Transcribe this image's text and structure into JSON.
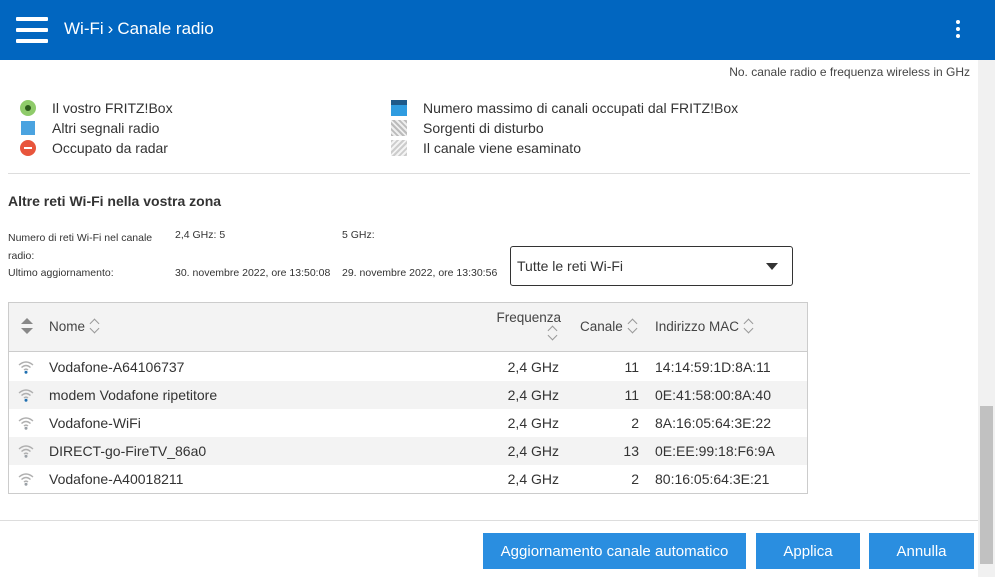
{
  "header": {
    "breadcrumb_parent": "Wi-Fi",
    "breadcrumb_separator": ">",
    "breadcrumb_current": "Canale radio"
  },
  "chart_note": "No. canale radio e frequenza wireless in GHz",
  "legend": [
    {
      "icon": "fritzbox-dot-icon",
      "label": "Il vostro FRITZ!Box"
    },
    {
      "icon": "other-signal-square-icon",
      "label": "Altri segnali radio"
    },
    {
      "icon": "radar-icon",
      "label": "Occupato da radar"
    },
    {
      "icon": "max-channels-icon",
      "label": "Numero massimo di canali occupati dal FRITZ!Box"
    },
    {
      "icon": "interference-icon",
      "label": "Sorgenti di disturbo"
    },
    {
      "icon": "scanning-icon",
      "label": "Il canale viene esaminato"
    }
  ],
  "section": {
    "title": "Altre reti Wi-Fi nella vostra zona",
    "count_label": "Numero di reti Wi-Fi nel canale radio:",
    "count_24": "2,4 GHz: 5",
    "count_5": "5 GHz:",
    "updated_label": "Ultimo aggiornamento:",
    "updated_24": "30. novembre 2022, ore 13:50:08",
    "updated_5": "29. novembre 2022, ore 13:30:56"
  },
  "filter": {
    "selected": "Tutte le reti Wi-Fi"
  },
  "table": {
    "headers": {
      "name": "Nome",
      "freq": "Frequenza",
      "channel": "Canale",
      "mac": "Indirizzo MAC"
    },
    "rows": [
      {
        "name": "Vodafone-A64106737",
        "freq": "2,4 GHz",
        "channel": "11",
        "mac": "14:14:59:1D:8A:11",
        "signal": 4
      },
      {
        "name": "modem Vodafone ripetitore",
        "freq": "2,4 GHz",
        "channel": "11",
        "mac": "0E:41:58:00:8A:40",
        "signal": 4
      },
      {
        "name": "Vodafone-WiFi",
        "freq": "2,4 GHz",
        "channel": "2",
        "mac": "8A:16:05:64:3E:22",
        "signal": 3
      },
      {
        "name": "DIRECT-go-FireTV_86a0",
        "freq": "2,4 GHz",
        "channel": "13",
        "mac": "0E:EE:99:18:F6:9A",
        "signal": 3
      },
      {
        "name": "Vodafone-A40018211",
        "freq": "2,4 GHz",
        "channel": "2",
        "mac": "80:16:05:64:3E:21",
        "signal": 3
      }
    ]
  },
  "buttons": {
    "auto_update": "Aggiornamento canale automatico",
    "apply": "Applica",
    "cancel": "Annulla"
  },
  "colors": {
    "header_bg": "#0166c0",
    "button_bg": "#2a8ee0"
  }
}
